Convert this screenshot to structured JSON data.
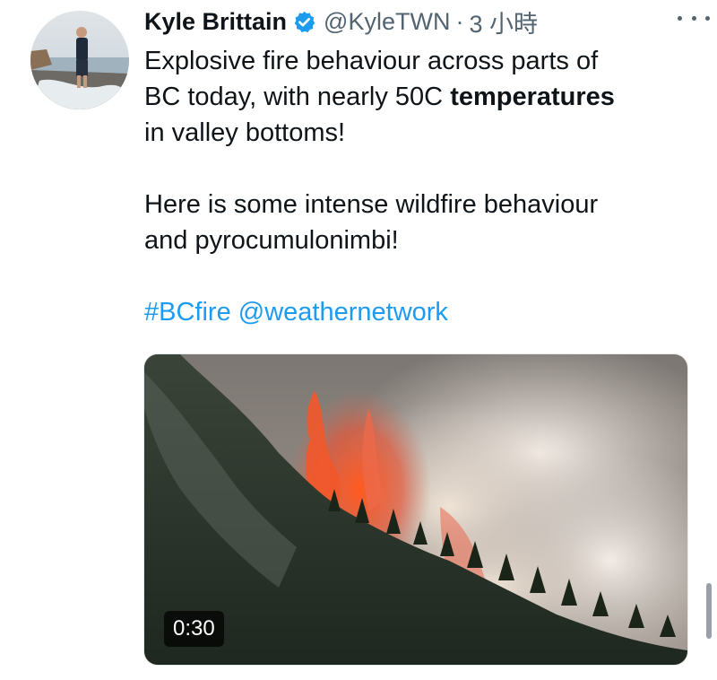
{
  "author": {
    "display_name": "Kyle Brittain",
    "handle": "@KyleTWN",
    "separator": "·",
    "timestamp": "3 小時",
    "verified_icon": "verified-badge-icon"
  },
  "tweet": {
    "line1_pre": "Explosive fire behaviour across parts of",
    "line2_pre": "BC today, with nearly 50C ",
    "line2_bold": "temperatures",
    "line3": "in valley bottoms!",
    "para2_line1": "Here is some intense wildfire behaviour",
    "para2_line2": "and pyrocumulonimbi!",
    "hashtag": "#BCfire",
    "mention": "@weathernetwork"
  },
  "media": {
    "type": "video",
    "duration": "0:30"
  },
  "colors": {
    "link": "#1d9bf0",
    "secondary_text": "#536471",
    "verified": "#1d9bf0"
  }
}
